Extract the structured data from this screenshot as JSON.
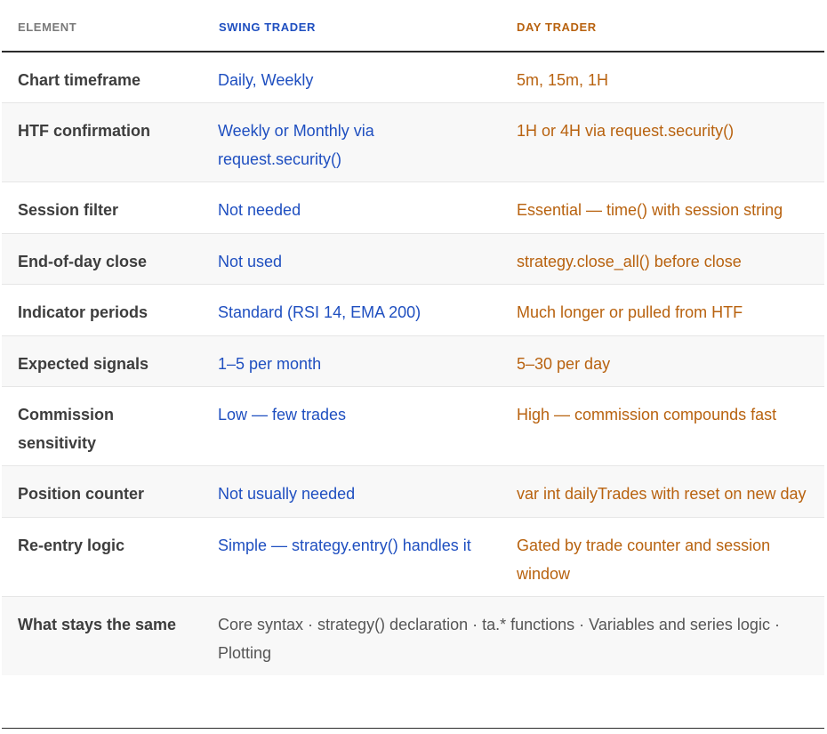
{
  "headers": {
    "element": "ELEMENT",
    "swing": "SWING TRADER",
    "day": "DAY TRADER"
  },
  "rows": [
    {
      "element": "Chart timeframe",
      "swing": "Daily, Weekly",
      "day": "5m, 15m, 1H"
    },
    {
      "element": "HTF confirmation",
      "swing": "Weekly or Monthly via request.security()",
      "day": "1H or 4H via request.security()"
    },
    {
      "element": "Session filter",
      "swing": "Not needed",
      "day": "Essential — time() with session string"
    },
    {
      "element": "End-of-day close",
      "swing": "Not used",
      "day": "strategy.close_all() before close"
    },
    {
      "element": "Indicator periods",
      "swing": "Standard (RSI 14, EMA 200)",
      "day": "Much longer or pulled from HTF"
    },
    {
      "element": "Expected signals",
      "swing": "1–5 per month",
      "day": "5–30 per day"
    },
    {
      "element": "Commission sensitivity",
      "swing": "Low — few trades",
      "day": "High — commission compounds fast"
    },
    {
      "element": "Position counter",
      "swing": "Not usually needed",
      "day": "var int dailyTrades with reset on new day"
    },
    {
      "element": "Re-entry logic",
      "swing": "Simple — strategy.entry() handles it",
      "day": "Gated by trade counter and session window"
    }
  ],
  "same": {
    "element": "What stays the same",
    "text": "Core syntax · strategy() declaration · ta.* functions · Variables and series logic · Plotting"
  },
  "colors": {
    "swing": "#1f4fc0",
    "day": "#b8620f",
    "element": "#3d3d3d",
    "header_element": "#7a7a7a",
    "same_text": "#555555",
    "alt_row_bg": "#f8f8f8"
  }
}
